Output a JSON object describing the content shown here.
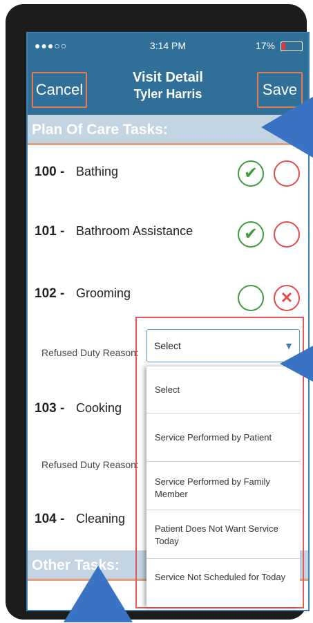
{
  "status_bar": {
    "signal": "●●●○○ ",
    "time": "3:14 PM",
    "battery": "17%"
  },
  "nav": {
    "cancel": "Cancel",
    "title": "Visit Detail",
    "subtitle": "Tyler Harris",
    "save": "Save"
  },
  "plan_section": "Plan Of Care Tasks:",
  "tasks": [
    {
      "num": "100 -",
      "name": "Bathing"
    },
    {
      "num": "101 -",
      "name": "Bathroom Assistance"
    },
    {
      "num": "102 -",
      "name": "Grooming",
      "reason_label": "Refused Duty Reason:"
    },
    {
      "num": "103 -",
      "name": "Cooking",
      "reason_label": "Refused Duty Reason:"
    },
    {
      "num": "104 -",
      "name": "Cleaning"
    }
  ],
  "other_section": "Other Tasks:",
  "dropdown": {
    "selected": "Select",
    "options": [
      "Select",
      "Service Performed by Patient",
      "Service Performed by Family Member",
      "Patient Does Not Want Service Today",
      "Service Not Scheduled for Today"
    ]
  },
  "colors": {
    "nav": "#2f6f98",
    "section": "#c3d4e2",
    "accent": "#e67a52",
    "check": "#3e9b3e",
    "refuse": "#e04b4b",
    "pointer": "#3a72c4"
  }
}
